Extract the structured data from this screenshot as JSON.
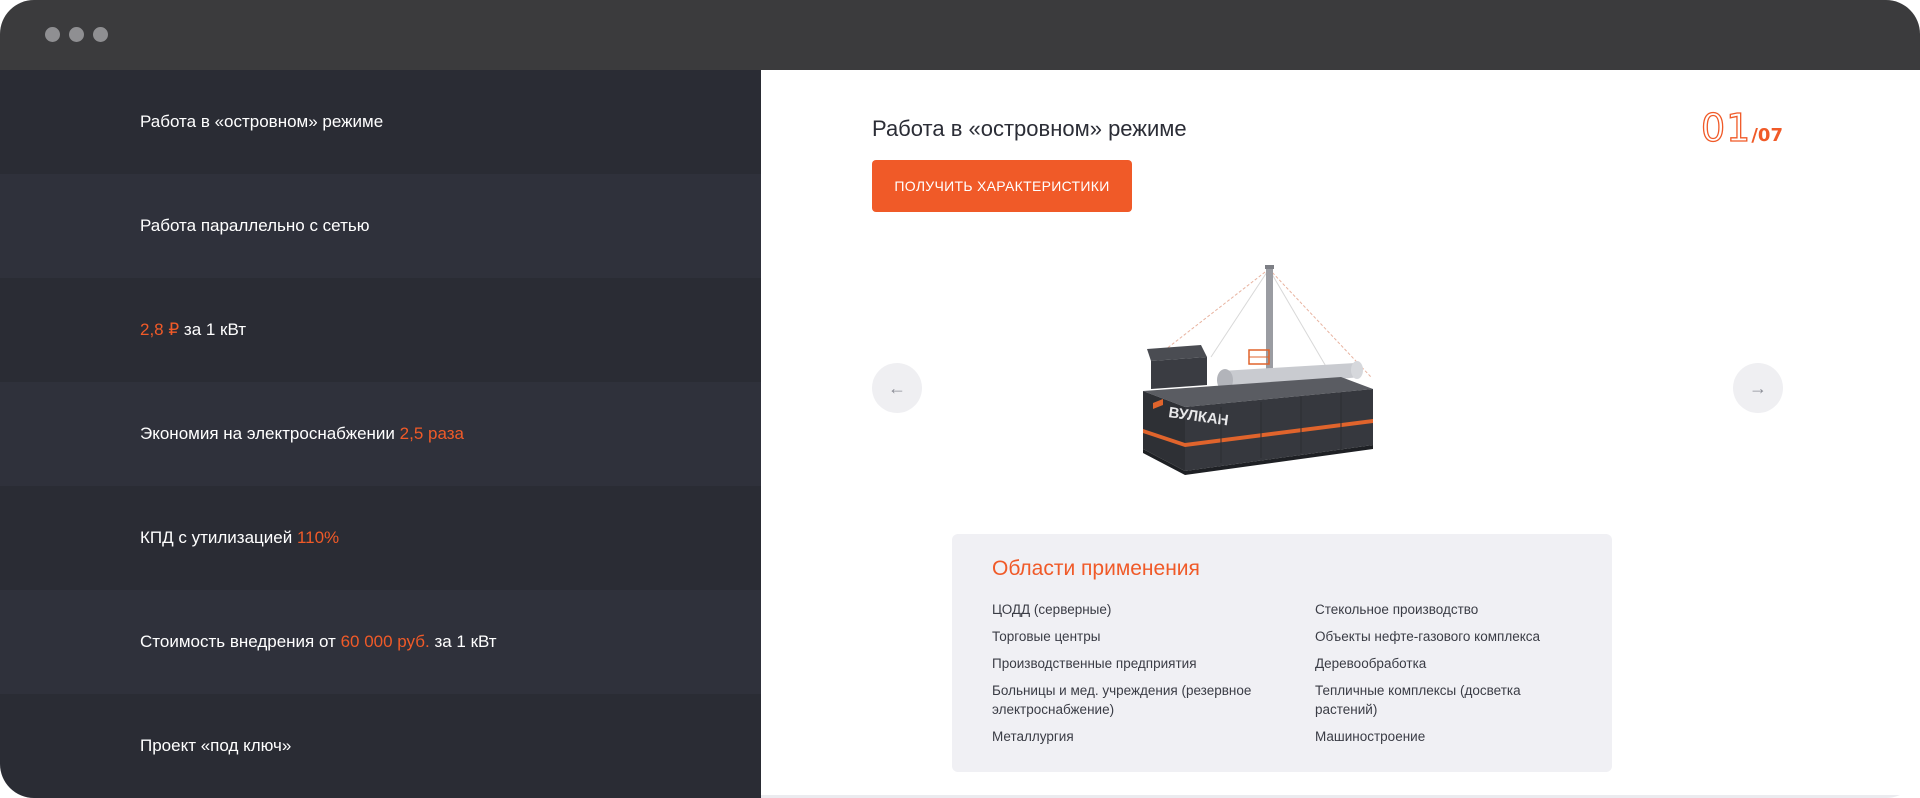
{
  "sidebar": {
    "items": [
      {
        "pre": "Работа в «островном» режиме",
        "hl": "",
        "post": ""
      },
      {
        "pre": "Работа параллельно с сетью",
        "hl": "",
        "post": ""
      },
      {
        "pre": "",
        "hl": "2,8 ₽",
        "post": " за 1 кВт"
      },
      {
        "pre": "Экономия на электроснабжении ",
        "hl": "2,5 раза",
        "post": ""
      },
      {
        "pre": "КПД с утилизацией ",
        "hl": "110%",
        "post": ""
      },
      {
        "pre": "Стоимость внедрения от ",
        "hl": "60 000 руб.",
        "post": " за 1 кВт"
      },
      {
        "pre": "Проект «под ключ»",
        "hl": "",
        "post": ""
      }
    ]
  },
  "slide": {
    "title": "Работа в «островном» режиме",
    "counter_current": "01",
    "counter_total": "/07",
    "cta_label": "ПОЛУЧИТЬ ХАРАКТЕРИСТИКИ",
    "prev_icon": "←",
    "next_icon": "→",
    "product_brand": "ВУЛКАН"
  },
  "applications": {
    "title": "Области применения",
    "col1": [
      "ЦОДД (серверные)",
      "Торговые центры",
      "Производственные предприятия",
      "Больницы и мед. учреждения (резервное электроснабжение)",
      "Металлургия"
    ],
    "col2": [
      "Стекольное производство",
      "Объекты нефте-газового комплекса",
      "Деревообработка",
      "Тепличные комплексы (досветка растений)",
      "Машиностроение"
    ]
  },
  "colors": {
    "accent": "#f05a28",
    "sidebar_bg": "#2a2c34",
    "sidebar_alt": "#2f313b",
    "titlebar": "#3b3b3d"
  },
  "icons": {
    "prev": "arrow-left-icon",
    "next": "arrow-right-icon"
  }
}
